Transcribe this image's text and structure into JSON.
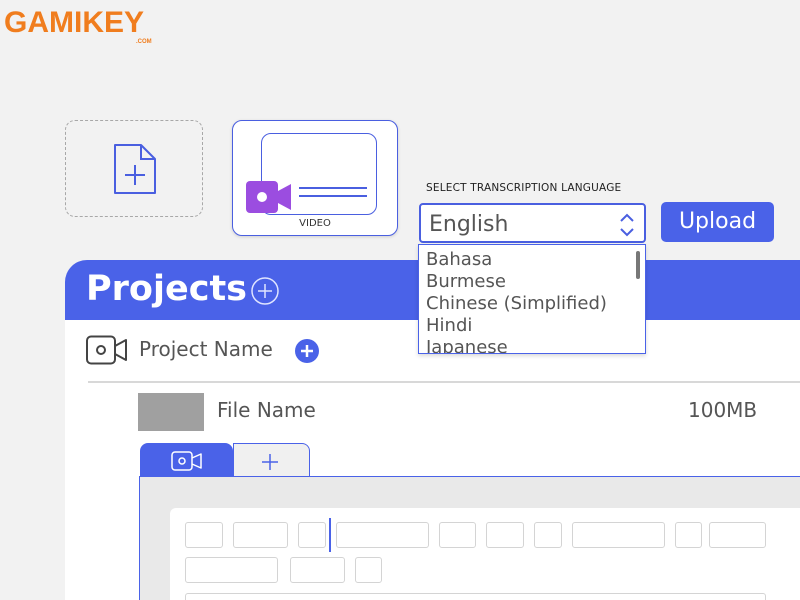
{
  "logo": {
    "text": "GAMIKEY",
    "suffix": ".COM"
  },
  "upload_area": {
    "add_file_icon": "file-plus-icon",
    "video_card": {
      "label": "VIDEO",
      "icon": "video-camera-icon"
    }
  },
  "language": {
    "label": "SELECT TRANSCRIPTION LANGUAGE",
    "selected": "English",
    "options": [
      "Bahasa",
      "Burmese",
      "Chinese (Simplified)",
      "Hindi",
      "Japanese"
    ]
  },
  "upload_button": {
    "label": "Upload"
  },
  "projects": {
    "title": "Projects",
    "project": {
      "name": "Project Name"
    },
    "file": {
      "name": "File Name",
      "size": "100MB"
    }
  },
  "colors": {
    "accent": "#4a62e8",
    "brand": "#f07d1e",
    "camera": "#9b4de0"
  }
}
